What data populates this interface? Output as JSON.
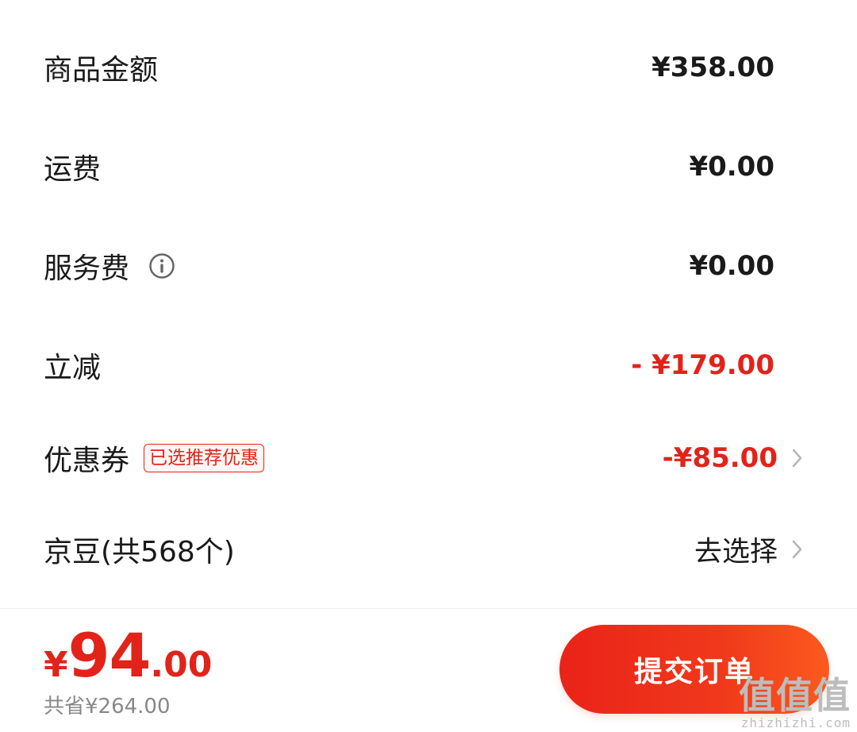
{
  "rows": {
    "goods_amount": {
      "label": "商品金额",
      "value": "¥358.00"
    },
    "shipping": {
      "label": "运费",
      "value": "¥0.00"
    },
    "service_fee": {
      "label": "服务费",
      "value": "¥0.00"
    },
    "instant_discount": {
      "label": "立减",
      "value": "- ¥179.00"
    },
    "coupon": {
      "label": "优惠券",
      "tag": "已选推荐优惠",
      "value": "-¥85.00"
    },
    "jingdou": {
      "label": "京豆(共568个)",
      "value": "去选择"
    }
  },
  "footer": {
    "currency": "¥",
    "total_int": "94",
    "total_dec": ".00",
    "saved": "共省¥264.00",
    "submit_label": "提交订单"
  },
  "watermark": {
    "cn": "值值值",
    "en": "zhizhizhi.com"
  },
  "colors": {
    "accent": "#e2231a",
    "text": "#1a1a1a",
    "muted": "#888888"
  },
  "icons": {
    "info": "info-circle-icon",
    "chevron": "chevron-right-icon"
  }
}
